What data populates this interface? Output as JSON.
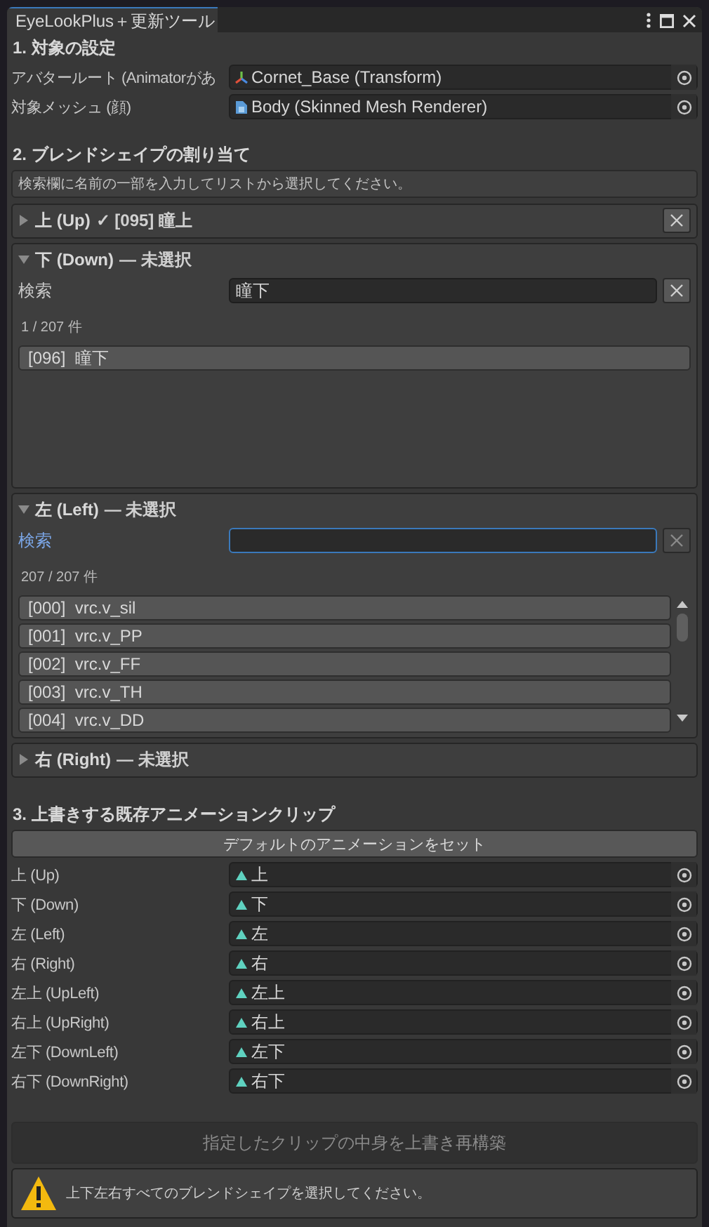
{
  "window": {
    "title": "EyeLookPlus＋更新ツール"
  },
  "target": {
    "heading": "1. 対象の設定",
    "fields": [
      {
        "label": "アバタールート (Animatorがあ",
        "value": "Cornet_Base (Transform)",
        "kind": "transform"
      },
      {
        "label": "対象メッシュ (顔)",
        "value": "Body (Skinned Mesh Renderer)",
        "kind": "mesh"
      }
    ]
  },
  "blendshapes": {
    "heading": "2. ブレンドシェイプの割り当て",
    "help": "検索欄に名前の一部を入力してリストから選択してください。",
    "foldouts": [
      {
        "title": "上 (Up)",
        "status": "✓ [095] 瞳上",
        "expanded": false,
        "clear": true
      },
      {
        "title": "下 (Down)",
        "status": "— 未選択",
        "expanded": true,
        "search_label": "検索",
        "search_value": "瞳下",
        "focused": false,
        "clear_enabled": true,
        "count": "1 / 207 件",
        "items": [
          "[096]  瞳下"
        ]
      },
      {
        "title": "左 (Left)",
        "status": "— 未選択",
        "expanded": true,
        "search_label": "検索",
        "focused": true,
        "clear_enabled": false,
        "count": "207 / 207 件",
        "items": [
          "[000]  vrc.v_sil",
          "[001]  vrc.v_PP",
          "[002]  vrc.v_FF",
          "[003]  vrc.v_TH",
          "[004]  vrc.v_DD"
        ]
      },
      {
        "title": "右 (Right)",
        "status": "— 未選択",
        "expanded": false,
        "clear": false
      }
    ]
  },
  "clips": {
    "heading": "3. 上書きする既存アニメーションクリップ",
    "default_button": "デフォルトのアニメーションをセット",
    "rows": [
      {
        "label": "上 (Up)",
        "value": "上"
      },
      {
        "label": "下 (Down)",
        "value": "下"
      },
      {
        "label": "左 (Left)",
        "value": "左"
      },
      {
        "label": "右 (Right)",
        "value": "右"
      },
      {
        "label": "左上 (UpLeft)",
        "value": "左上"
      },
      {
        "label": "右上 (UpRight)",
        "value": "右上"
      },
      {
        "label": "左下 (DownLeft)",
        "value": "左下"
      },
      {
        "label": "右下 (DownRight)",
        "value": "右下"
      }
    ]
  },
  "rebuild_button": {
    "label": "指定したクリップの中身を上書き再構築",
    "disabled": true
  },
  "warning": {
    "text": "上下左右すべてのブレンドシェイプを選択してください。"
  }
}
